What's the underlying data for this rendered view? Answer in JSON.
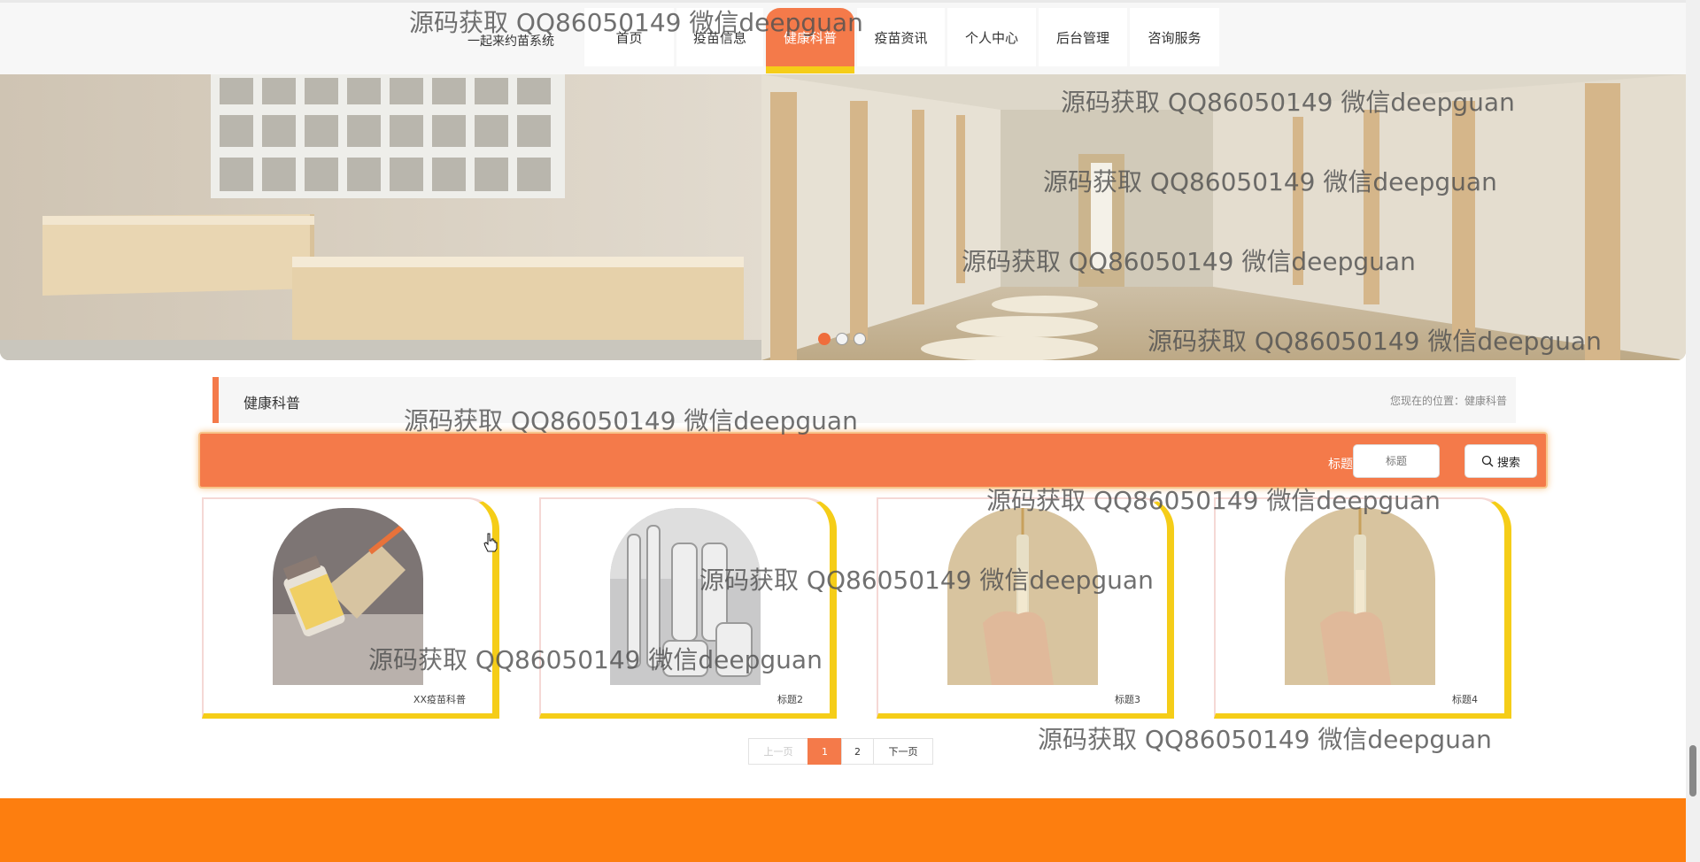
{
  "brand": "一起来约苗系统",
  "nav": [
    "首页",
    "疫苗信息",
    "健康科普",
    "疫苗资讯",
    "个人中心",
    "后台管理",
    "咨询服务"
  ],
  "section": {
    "title": "健康科普",
    "breadcrumb": "您现在的位置：健康科普"
  },
  "search": {
    "label": "标题",
    "placeholder": "标题",
    "button": "搜索",
    "button_icon": "search-icon"
  },
  "cards": [
    {
      "title": "XX疫苗科普",
      "image": "vaccine-vial-image"
    },
    {
      "title": "标题2",
      "image": "vaccine-ampoules-image"
    },
    {
      "title": "标题3",
      "image": "syringe-hand-image"
    },
    {
      "title": "标题4",
      "image": "syringe-hand-image"
    }
  ],
  "pagination": {
    "prev": "上一页",
    "pages": [
      "1",
      "2"
    ],
    "current": "1",
    "next": "下一页"
  },
  "watermark": "源码获取 QQ86050149 微信deepguan",
  "colors": {
    "accent": "#f47a4a",
    "highlight": "#f5cd18",
    "footer": "#fd7e0f"
  }
}
